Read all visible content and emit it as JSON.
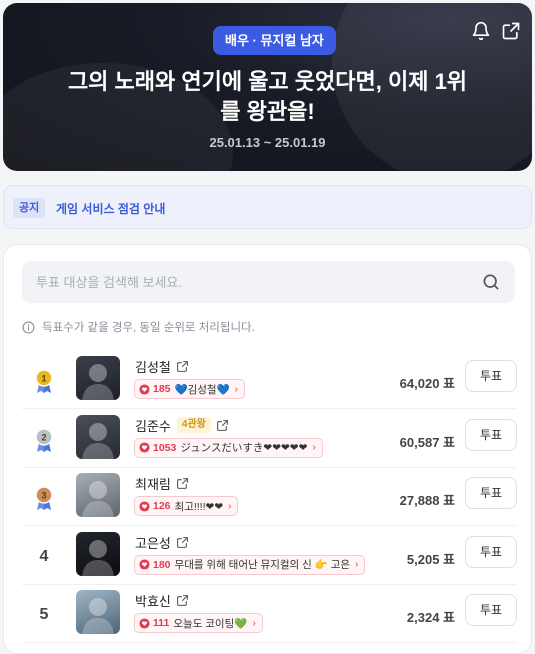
{
  "hero": {
    "category": "배우 · 뮤지컬 남자",
    "title": "그의 노래와 연기에 울고 웃었다면, 이제 1위를 왕관을!",
    "title_line1": "그의 노래와 연기에 울고 웃었다면, 이제 1위",
    "title_line2": "를 왕관을!",
    "period": "25.01.13 ~ 25.01.19"
  },
  "notice": {
    "tag": "공지",
    "text": "게임 서비스 점검 안내"
  },
  "search": {
    "placeholder": "투표 대상을 검색해 보세요."
  },
  "info_text": "득표수가 같을 경우, 동일 순위로 처리됩니다.",
  "vote_label": "투표",
  "colors": {
    "accent": "#3b5be3",
    "cheer": "#e23c4f",
    "gold": "#e8b923",
    "silver": "#b8c0cc",
    "bronze": "#d08c5a"
  },
  "ranking": [
    {
      "rank": "1",
      "medal": "gold",
      "name": "김성철",
      "tag": "",
      "cheer_count": "185",
      "cheer_msg": "💙김성철💙",
      "votes": "64,020 표"
    },
    {
      "rank": "2",
      "medal": "silver",
      "name": "김준수",
      "tag": "4관왕",
      "cheer_count": "1053",
      "cheer_msg": "ジュンスだいすき❤❤❤❤❤",
      "votes": "60,587 표"
    },
    {
      "rank": "3",
      "medal": "bronze",
      "name": "최재림",
      "tag": "",
      "cheer_count": "126",
      "cheer_msg": "최고!!!!❤❤",
      "votes": "27,888 표"
    },
    {
      "rank": "4",
      "medal": "",
      "name": "고은성",
      "tag": "",
      "cheer_count": "180",
      "cheer_msg": "무대를 위해 태어난 뮤지컬의 신 👉 고은",
      "votes": "5,205 표"
    },
    {
      "rank": "5",
      "medal": "",
      "name": "박효신",
      "tag": "",
      "cheer_count": "111",
      "cheer_msg": "오늘도 코이팅💚",
      "votes": "2,324 표"
    }
  ]
}
